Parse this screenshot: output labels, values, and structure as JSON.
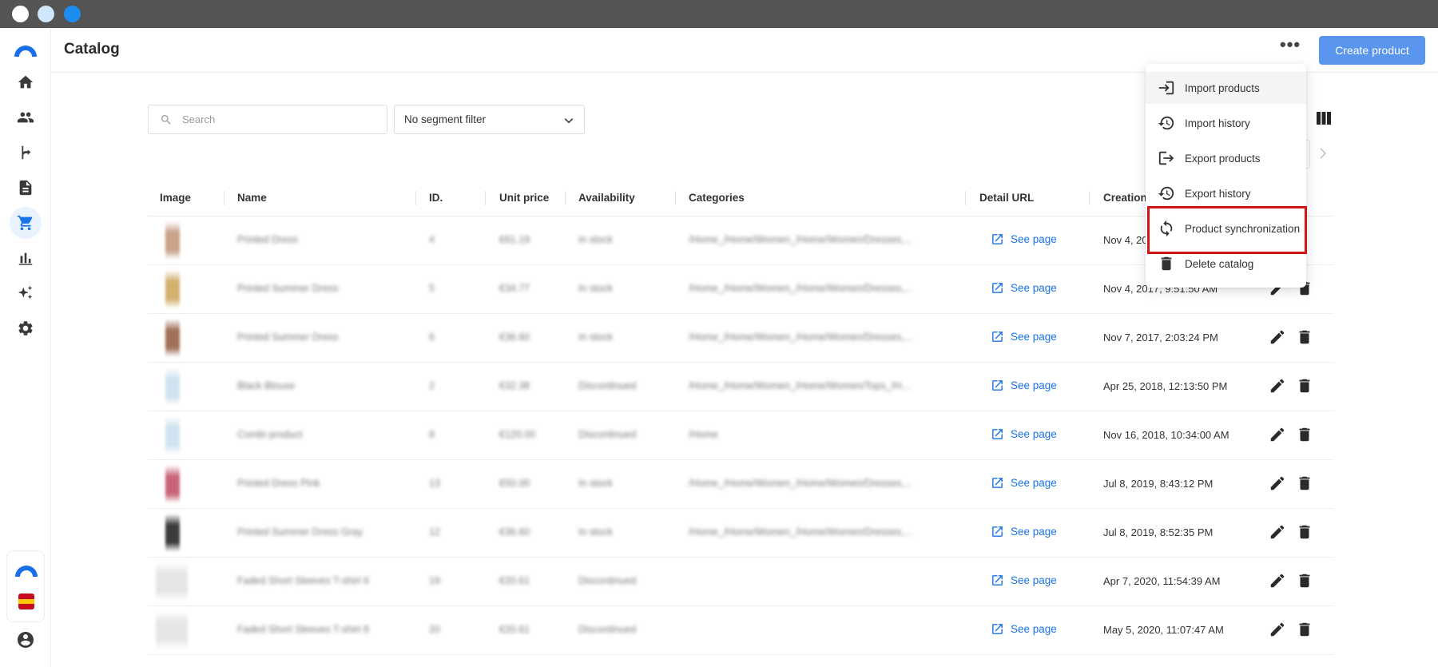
{
  "window": {
    "title": "Catalog"
  },
  "header": {
    "title": "Catalog",
    "more_label": "•••",
    "create_label": "Create product"
  },
  "sidebar": {
    "items": [
      {
        "icon": "home-icon"
      },
      {
        "icon": "people-icon"
      },
      {
        "icon": "flow-icon"
      },
      {
        "icon": "document-icon"
      },
      {
        "icon": "cart-icon",
        "active": true
      },
      {
        "icon": "bar-chart-icon"
      },
      {
        "icon": "sparkle-icon"
      },
      {
        "icon": "gear-icon"
      }
    ]
  },
  "filters": {
    "search_placeholder": "Search",
    "segment_label": "No segment filter"
  },
  "table": {
    "columns": [
      "Image",
      "Name",
      "ID.",
      "Unit price",
      "Availability",
      "Categories",
      "Detail URL",
      "Creation"
    ],
    "rows": [
      {
        "name": "Printed Dress",
        "id": "4",
        "price": "€61.19",
        "availability": "In stock",
        "categories": "/Home_/Home/Women_/Home/Women/Dresses,...",
        "url": "See page",
        "created": "Nov 4, 20",
        "img": "#c9a289"
      },
      {
        "name": "Printed Summer Dress",
        "id": "5",
        "price": "€34.77",
        "availability": "In stock",
        "categories": "/Home_/Home/Women_/Home/Women/Dresses,...",
        "url": "See page",
        "created": "Nov 4, 2017, 9:51:50 AM",
        "img": "#d4b06e"
      },
      {
        "name": "Printed Summer Dress",
        "id": "6",
        "price": "€36.60",
        "availability": "In stock",
        "categories": "/Home_/Home/Women_/Home/Women/Dresses,...",
        "url": "See page",
        "created": "Nov 7, 2017, 2:03:24 PM",
        "img": "#a0705a"
      },
      {
        "name": "Black Blouse",
        "id": "2",
        "price": "€32.38",
        "availability": "Discontinued",
        "categories": "/Home_/Home/Women_/Home/Women/Tops_/H...",
        "url": "See page",
        "created": "Apr 25, 2018, 12:13:50 PM",
        "img": "#cfe3f0"
      },
      {
        "name": "Combi product",
        "id": "8",
        "price": "€120.00",
        "availability": "Discontinued",
        "categories": "/Home",
        "url": "See page",
        "created": "Nov 16, 2018, 10:34:00 AM",
        "img": "#cfe3f0"
      },
      {
        "name": "Printed Dress Pink",
        "id": "13",
        "price": "€50.00",
        "availability": "In stock",
        "categories": "/Home_/Home/Women_/Home/Women/Dresses,...",
        "url": "See page",
        "created": "Jul 8, 2019, 8:43:12 PM",
        "img": "#c86478"
      },
      {
        "name": "Printed Summer Dress Gray",
        "id": "12",
        "price": "€36.60",
        "availability": "In stock",
        "categories": "/Home_/Home/Women_/Home/Women/Dresses,...",
        "url": "See page",
        "created": "Jul 8, 2019, 8:52:35 PM",
        "img": "#3c3c3c"
      },
      {
        "name": "Faded Short Sleeves T-shirt 6",
        "id": "19",
        "price": "€20.61",
        "availability": "Discontinued",
        "categories": "",
        "url": "See page",
        "created": "Apr 7, 2020, 11:54:39 AM",
        "img": "#e6e6e6"
      },
      {
        "name": "Faded Short Sleeves T-shirt 8",
        "id": "20",
        "price": "€20.61",
        "availability": "Discontinued",
        "categories": "",
        "url": "See page",
        "created": "May 5, 2020, 11:07:47 AM",
        "img": "#e6e6e6"
      }
    ]
  },
  "menu": {
    "items": [
      {
        "label": "Import products",
        "icon": "import-icon"
      },
      {
        "label": "Import history",
        "icon": "history-icon"
      },
      {
        "label": "Export products",
        "icon": "export-icon"
      },
      {
        "label": "Export history",
        "icon": "history-icon"
      },
      {
        "label": "Product synchronization",
        "icon": "sync-icon",
        "highlighted": true
      },
      {
        "label": "Delete catalog",
        "icon": "trash-icon"
      }
    ]
  },
  "colors": {
    "accent": "#1a73e8",
    "primary_button": "#5b96ee",
    "highlight": "#d11616"
  }
}
